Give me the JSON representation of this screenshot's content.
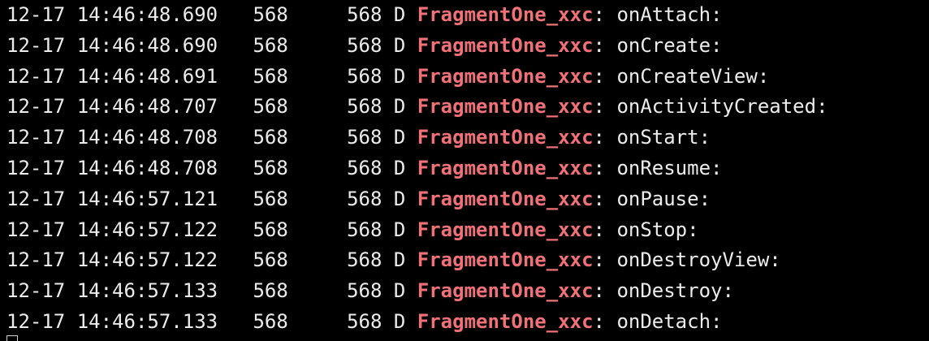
{
  "theme": {
    "background": "#000000",
    "text_color": "#ececec",
    "tag_color": "#f07178"
  },
  "log": {
    "lines": [
      {
        "date": "12-17",
        "time": "14:46:48.690",
        "pid": "568",
        "tid": "568",
        "level": "D",
        "tag": "FragmentOne_xxc",
        "message": "onAttach:"
      },
      {
        "date": "12-17",
        "time": "14:46:48.690",
        "pid": "568",
        "tid": "568",
        "level": "D",
        "tag": "FragmentOne_xxc",
        "message": "onCreate:"
      },
      {
        "date": "12-17",
        "time": "14:46:48.691",
        "pid": "568",
        "tid": "568",
        "level": "D",
        "tag": "FragmentOne_xxc",
        "message": "onCreateView:"
      },
      {
        "date": "12-17",
        "time": "14:46:48.707",
        "pid": "568",
        "tid": "568",
        "level": "D",
        "tag": "FragmentOne_xxc",
        "message": "onActivityCreated:"
      },
      {
        "date": "12-17",
        "time": "14:46:48.708",
        "pid": "568",
        "tid": "568",
        "level": "D",
        "tag": "FragmentOne_xxc",
        "message": "onStart:"
      },
      {
        "date": "12-17",
        "time": "14:46:48.708",
        "pid": "568",
        "tid": "568",
        "level": "D",
        "tag": "FragmentOne_xxc",
        "message": "onResume:"
      },
      {
        "date": "12-17",
        "time": "14:46:57.121",
        "pid": "568",
        "tid": "568",
        "level": "D",
        "tag": "FragmentOne_xxc",
        "message": "onPause:"
      },
      {
        "date": "12-17",
        "time": "14:46:57.122",
        "pid": "568",
        "tid": "568",
        "level": "D",
        "tag": "FragmentOne_xxc",
        "message": "onStop:"
      },
      {
        "date": "12-17",
        "time": "14:46:57.122",
        "pid": "568",
        "tid": "568",
        "level": "D",
        "tag": "FragmentOne_xxc",
        "message": "onDestroyView:"
      },
      {
        "date": "12-17",
        "time": "14:46:57.133",
        "pid": "568",
        "tid": "568",
        "level": "D",
        "tag": "FragmentOne_xxc",
        "message": "onDestroy:"
      },
      {
        "date": "12-17",
        "time": "14:46:57.133",
        "pid": "568",
        "tid": "568",
        "level": "D",
        "tag": "FragmentOne_xxc",
        "message": "onDetach:"
      }
    ]
  }
}
